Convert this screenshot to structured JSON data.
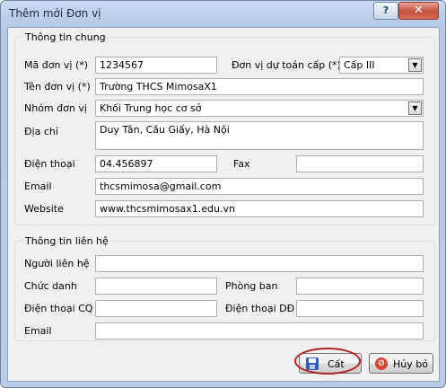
{
  "window": {
    "title": "Thêm mới Đơn vị",
    "help": "?",
    "close": "✕"
  },
  "general": {
    "title": "Thông tin chung",
    "ma_don_vi_label": "Mã đơn vị (*)",
    "ma_don_vi_value": "1234567",
    "don_vi_du_toan_label": "Đơn vị dự toán cấp (*)",
    "don_vi_du_toan_value": "Cấp III",
    "ten_don_vi_label": "Tên đơn vị (*)",
    "ten_don_vi_value": "Trường THCS MimosaX1",
    "nhom_don_vi_label": "Nhóm đơn vị",
    "nhom_don_vi_value": "Khối Trung học cơ sở",
    "dia_chi_label": "Địa chỉ",
    "dia_chi_value": "Duy Tân, Cầu Giấy, Hà Nội",
    "dien_thoai_label": "Điện thoại",
    "dien_thoai_value": "04.456897",
    "fax_label": "Fax",
    "fax_value": "",
    "email_label": "Email",
    "email_value": "thcsmimosa@gmail.com",
    "website_label": "Website",
    "website_value": "www.thcsmimosax1.edu.vn"
  },
  "contact": {
    "title": "Thông tin liên hệ",
    "nguoi_lien_he_label": "Người liên hệ",
    "chuc_danh_label": "Chức danh",
    "phong_ban_label": "Phòng ban",
    "dien_thoai_cq_label": "Điện thoại CQ",
    "dien_thoai_dd_label": "Điện thoại DĐ",
    "email_label": "Email"
  },
  "buttons": {
    "save": "Cất",
    "cancel": "Hủy bỏ"
  },
  "colors": {
    "highlight": "#b02020",
    "title_bar": "#b9cde8"
  }
}
